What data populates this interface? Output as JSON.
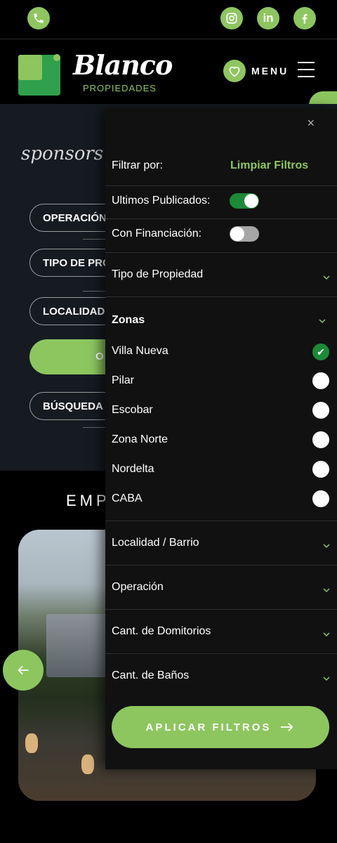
{
  "topbar": {
    "icons": {
      "phone": "phone-icon",
      "instagram": "instagram-icon",
      "linkedin": "linkedin-icon",
      "facebook": "facebook-icon"
    },
    "linkedin_text": "in"
  },
  "header": {
    "logo_word": "Blanco",
    "logo_sub": "PROPIEDADES",
    "menu_label": "MENU"
  },
  "background_page": {
    "sponsors": "sponsors",
    "pills": [
      "OPERACIÓN",
      "TIPO DE PRO",
      "LOCALIDAD",
      "BÚSQUEDA"
    ],
    "green_pill": "O",
    "section_title": "EMP"
  },
  "filter": {
    "close": "×",
    "filter_by": "Filtrar por:",
    "clear": "Limpiar Filtros",
    "toggles": [
      {
        "label": "Ultimos Publicados:",
        "on": true
      },
      {
        "label": "Con Financiación:",
        "on": false
      }
    ],
    "sections": {
      "tipo": "Tipo de Propiedad",
      "zonas": "Zonas",
      "localidad": "Localidad / Barrio",
      "operacion": "Operación",
      "dormitorios": "Cant. de Domitorios",
      "banos": "Cant. de Baños"
    },
    "zonas": [
      {
        "label": "Villa Nueva",
        "selected": true
      },
      {
        "label": "Pilar",
        "selected": false
      },
      {
        "label": "Escobar",
        "selected": false
      },
      {
        "label": "Zona Norte",
        "selected": false
      },
      {
        "label": "Nordelta",
        "selected": false
      },
      {
        "label": "CABA",
        "selected": false
      }
    ],
    "checkmark": "✔",
    "apply_label": "APLICAR FILTROS"
  },
  "colors": {
    "accent": "#8dc65f",
    "selected": "#1c8a38",
    "drawer_bg": "#111111"
  }
}
